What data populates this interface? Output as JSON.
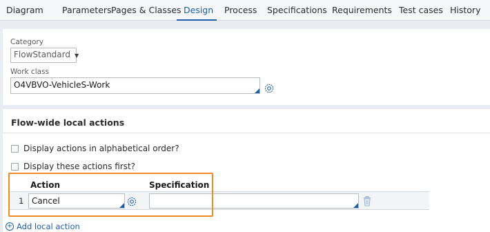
{
  "tabs": [
    {
      "label": "Diagram"
    },
    {
      "label": "Parameters"
    },
    {
      "label": "Pages & Classes"
    },
    {
      "label": "Design"
    },
    {
      "label": "Process"
    },
    {
      "label": "Specifications"
    },
    {
      "label": "Requirements"
    },
    {
      "label": "Test cases"
    },
    {
      "label": "History"
    }
  ],
  "active_tab": "Design",
  "category": {
    "label": "Category",
    "value": "FlowStandard"
  },
  "work_class": {
    "label": "Work class",
    "value": "O4VBVO-VehicleS-Work"
  },
  "flow_actions": {
    "title": "Flow-wide local actions",
    "alphabetical_label": "Display actions in alphabetical order?",
    "first_label": "Display these actions first?",
    "columns": {
      "action": "Action",
      "specification": "Specification"
    },
    "rows": [
      {
        "num": "1",
        "action": "Cancel",
        "specification": ""
      }
    ],
    "add_label": "Add local action"
  },
  "colors": {
    "accent": "#1f5fa9",
    "highlight": "#f08a24"
  }
}
